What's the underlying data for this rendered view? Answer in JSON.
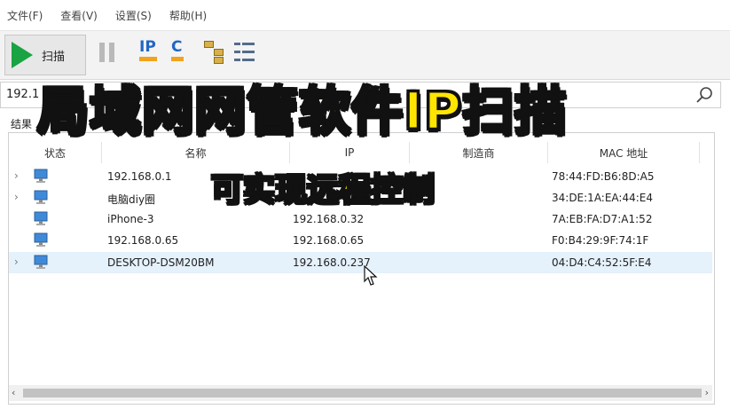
{
  "menu": {
    "items": [
      "文件(F)",
      "查看(V)",
      "设置(S)",
      "帮助(H)"
    ]
  },
  "toolbar": {
    "scan_label": "扫描",
    "ip_label": "IP",
    "c_label": "C"
  },
  "address": {
    "value": "192.1"
  },
  "tabs": {
    "results_label": "结果"
  },
  "table": {
    "columns": [
      "状态",
      "名称",
      "IP",
      "制造商",
      "MAC 地址"
    ],
    "rows": [
      {
        "name": "192.168.0.1",
        "ip": "",
        "vendor": "",
        "mac": "78:44:FD:B6:8D:A5",
        "expandable": true
      },
      {
        "name": "电脑diy圈",
        "ip": "",
        "vendor": "",
        "mac": "34:DE:1A:EA:44:E4",
        "expandable": true
      },
      {
        "name": "iPhone-3",
        "ip": "192.168.0.32",
        "vendor": "",
        "mac": "7A:EB:FA:D7:A1:52",
        "expandable": false
      },
      {
        "name": "192.168.0.65",
        "ip": "192.168.0.65",
        "vendor": "",
        "mac": "F0:B4:29:9F:74:1F",
        "expandable": false
      },
      {
        "name": "DESKTOP-DSM20BM",
        "ip": "192.168.0.237",
        "vendor": "",
        "mac": "04:D4:C4:52:5F:E4",
        "expandable": true,
        "selected": true
      }
    ]
  },
  "overlay": {
    "title": "局域网网管软件IP扫描",
    "subtitle": "可实现远程控制"
  },
  "colors": {
    "caption_fill": "#ffe600",
    "caption_stroke": "#111111",
    "scan_green": "#19a342",
    "ip_blue": "#2266c4",
    "selected_row": "#e5f1fb"
  }
}
